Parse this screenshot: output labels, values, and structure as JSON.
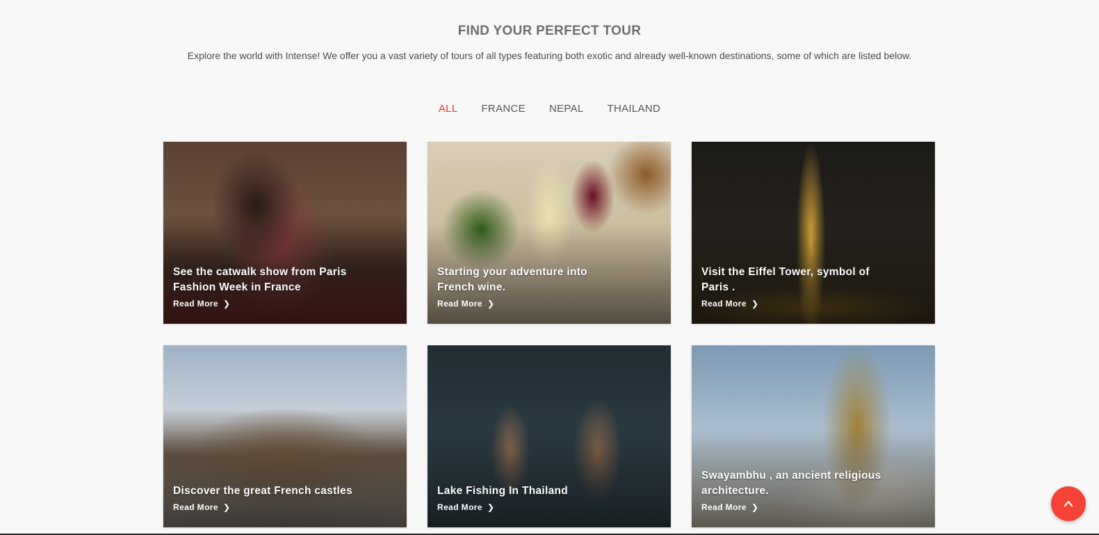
{
  "section": {
    "title": "FIND YOUR PERFECT TOUR",
    "intro": "Explore the world with Intense! We offer you a vast variety of tours of all types featuring both exotic and already well-known destinations, some of which are listed below."
  },
  "filters": [
    {
      "label": "ALL",
      "active": true
    },
    {
      "label": "FRANCE",
      "active": false
    },
    {
      "label": "NEPAL",
      "active": false
    },
    {
      "label": "THAILAND",
      "active": false
    }
  ],
  "tours": [
    {
      "title": "See the catwalk show from Paris Fashion Week in France",
      "link": "Read More",
      "image": "fashion-photo"
    },
    {
      "title": "Starting your adventure into French wine.",
      "link": "Read More",
      "image": "wine-photo"
    },
    {
      "title": "Visit the Eiffel Tower, symbol of Paris .",
      "link": "Read More",
      "image": "eiffel-tower-photo"
    },
    {
      "title": "Discover the great French castles",
      "link": "Read More",
      "image": "castle-photo"
    },
    {
      "title": "Lake Fishing In Thailand",
      "link": "Read More",
      "image": "fishing-photo"
    },
    {
      "title": "Swayambhu , an ancient religious architecture.",
      "link": "Read More",
      "image": "stupa-photo"
    }
  ],
  "colors": {
    "accent": "#e53935",
    "to_top_button": "#f44336",
    "background": "#f8f8f8"
  },
  "icons": {
    "read_more": "chevron-right-icon",
    "to_top": "chevron-up-icon"
  }
}
